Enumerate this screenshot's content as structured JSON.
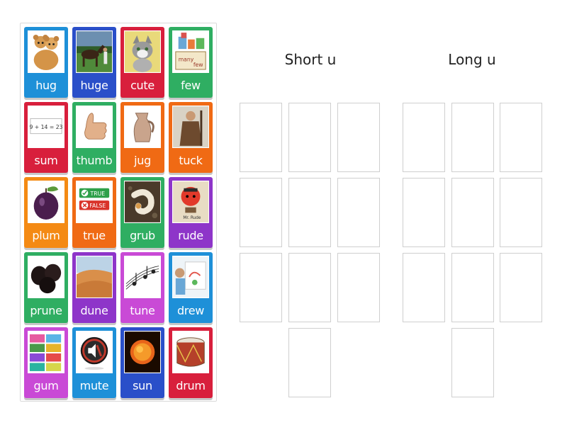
{
  "cards": [
    {
      "word": "hug",
      "color": "#1e90d8",
      "icon": "teddy-bears-hugging-icon"
    },
    {
      "word": "huge",
      "color": "#2a4fc9",
      "icon": "horse-and-man-icon"
    },
    {
      "word": "cute",
      "color": "#d81f3c",
      "icon": "kitten-icon"
    },
    {
      "word": "few",
      "color": "#2fae62",
      "icon": "many-few-icon"
    },
    {
      "word": "sum",
      "color": "#d81f3c",
      "icon": "math-sum-icon",
      "sum_text": "9 + 14 = 23"
    },
    {
      "word": "thumb",
      "color": "#2fae62",
      "icon": "thumbs-up-icon"
    },
    {
      "word": "jug",
      "color": "#f06a14",
      "icon": "jug-icon"
    },
    {
      "word": "tuck",
      "color": "#f06a14",
      "icon": "friar-tuck-icon"
    },
    {
      "word": "plum",
      "color": "#f48a14",
      "icon": "plum-icon"
    },
    {
      "word": "true",
      "color": "#f06a14",
      "icon": "true-false-icon",
      "true_text": "TRUE",
      "false_text": "FALSE"
    },
    {
      "word": "grub",
      "color": "#2fae62",
      "icon": "grub-icon"
    },
    {
      "word": "rude",
      "color": "#8e35c9",
      "icon": "mr-rude-icon"
    },
    {
      "word": "prune",
      "color": "#2fae62",
      "icon": "prunes-icon"
    },
    {
      "word": "dune",
      "color": "#8e35c9",
      "icon": "sand-dune-icon"
    },
    {
      "word": "tune",
      "color": "#c94ad6",
      "icon": "music-notes-icon"
    },
    {
      "word": "drew",
      "color": "#1e90d8",
      "icon": "child-drawing-icon"
    },
    {
      "word": "gum",
      "color": "#c94ad6",
      "icon": "gum-packs-icon"
    },
    {
      "word": "mute",
      "color": "#1e90d8",
      "icon": "mute-speaker-icon"
    },
    {
      "word": "sun",
      "color": "#2a4fc9",
      "icon": "sun-icon"
    },
    {
      "word": "drum",
      "color": "#d81f3c",
      "icon": "drum-icon"
    }
  ],
  "groups": [
    {
      "title": "Short u",
      "slot_count": 10
    },
    {
      "title": "Long u",
      "slot_count": 10
    }
  ]
}
